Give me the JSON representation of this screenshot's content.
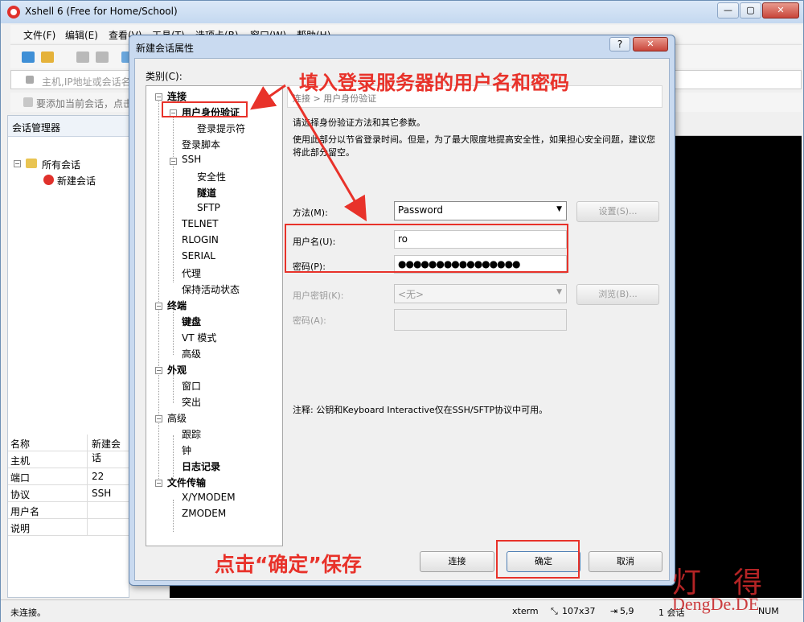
{
  "app": {
    "title": "Xshell 6 (Free for Home/School)",
    "window_controls": {
      "minimize": "—",
      "maximize": "▢",
      "close": "✕"
    }
  },
  "menu": [
    "文件(F)",
    "编辑(E)",
    "查看(V)",
    "工具(T)",
    "选项卡(B)",
    "窗口(W)",
    "帮助(H)"
  ],
  "address_bar": {
    "placeholder": "主机,IP地址或会话名"
  },
  "hint_bar": {
    "text": "要添加当前会话，点击"
  },
  "session_manager": {
    "header": "会话管理器",
    "tree": {
      "root": "所有会话",
      "child": "新建会话"
    },
    "properties": [
      {
        "key": "名称",
        "value": "新建会话"
      },
      {
        "key": "主机",
        "value": ""
      },
      {
        "key": "端口",
        "value": "22"
      },
      {
        "key": "协议",
        "value": "SSH"
      },
      {
        "key": "用户名",
        "value": ""
      },
      {
        "key": "说明",
        "value": ""
      }
    ]
  },
  "status_bar": {
    "connection": "未连接。",
    "terminal_type": "xterm",
    "size": "107x37",
    "cursor": "5,9",
    "sessions": "1 会话",
    "numlock": "NUM"
  },
  "dialog": {
    "title": "新建会话属性",
    "help": "?",
    "close": "✕",
    "category_label": "类别(C):",
    "tree": [
      {
        "label": "连接",
        "level": 0,
        "bold": true,
        "toggle": "−"
      },
      {
        "label": "用户身份验证",
        "level": 1,
        "bold": true,
        "toggle": "−",
        "selected": true
      },
      {
        "label": "登录提示符",
        "level": 2,
        "bold": false
      },
      {
        "label": "登录脚本",
        "level": 1,
        "bold": false
      },
      {
        "label": "SSH",
        "level": 1,
        "bold": false,
        "toggle": "−"
      },
      {
        "label": "安全性",
        "level": 2,
        "bold": false
      },
      {
        "label": "隧道",
        "level": 2,
        "bold": true
      },
      {
        "label": "SFTP",
        "level": 2,
        "bold": false
      },
      {
        "label": "TELNET",
        "level": 1,
        "bold": false
      },
      {
        "label": "RLOGIN",
        "level": 1,
        "bold": false
      },
      {
        "label": "SERIAL",
        "level": 1,
        "bold": false
      },
      {
        "label": "代理",
        "level": 1,
        "bold": false
      },
      {
        "label": "保持活动状态",
        "level": 1,
        "bold": false
      },
      {
        "label": "终端",
        "level": 0,
        "bold": true,
        "toggle": "−"
      },
      {
        "label": "键盘",
        "level": 1,
        "bold": true
      },
      {
        "label": "VT 模式",
        "level": 1,
        "bold": false
      },
      {
        "label": "高级",
        "level": 1,
        "bold": false
      },
      {
        "label": "外观",
        "level": 0,
        "bold": true,
        "toggle": "−"
      },
      {
        "label": "窗口",
        "level": 1,
        "bold": false
      },
      {
        "label": "突出",
        "level": 1,
        "bold": false
      },
      {
        "label": "高级",
        "level": 0,
        "bold": false,
        "toggle": "−"
      },
      {
        "label": "跟踪",
        "level": 1,
        "bold": false
      },
      {
        "label": "钟",
        "level": 1,
        "bold": false
      },
      {
        "label": "日志记录",
        "level": 1,
        "bold": true
      },
      {
        "label": "文件传输",
        "level": 0,
        "bold": true,
        "toggle": "−"
      },
      {
        "label": "X/YMODEM",
        "level": 1,
        "bold": false
      },
      {
        "label": "ZMODEM",
        "level": 1,
        "bold": false
      }
    ],
    "breadcrumb": "连接 > 用户身份验证",
    "description_1": "请选择身份验证方法和其它参数。",
    "description_2": "使用此部分以节省登录时间。但是，为了最大限度地提高安全性，如果担心安全问题，建议您将此部分留空。",
    "method_label": "方法(M):",
    "method_value": "Password",
    "settings_button": "设置(S)...",
    "username_label": "用户名(U):",
    "username_value": "ro",
    "password_label": "密码(P):",
    "password_value": "●●●●●●●●●●●●●●●●",
    "user_key_label": "用户密钥(K):",
    "user_key_value": "<无>",
    "browse_button": "浏览(B)...",
    "passphrase_label": "密码(A):",
    "note": "注释: 公钥和Keyboard Interactive仅在SSH/SFTP协议中可用。",
    "connect_button": "连接",
    "ok_button": "确定",
    "cancel_button": "取消"
  },
  "annotations": {
    "fill_in": "填入登录服务器的用户名和密码",
    "click_ok": "点击“确定”保存"
  },
  "watermark": {
    "cn": "灯得",
    "en": "DengDe.DE"
  },
  "colors": {
    "annotation_red": "#e8322a",
    "title_bar": "#c4d8f0",
    "terminal_bg": "#000000"
  }
}
